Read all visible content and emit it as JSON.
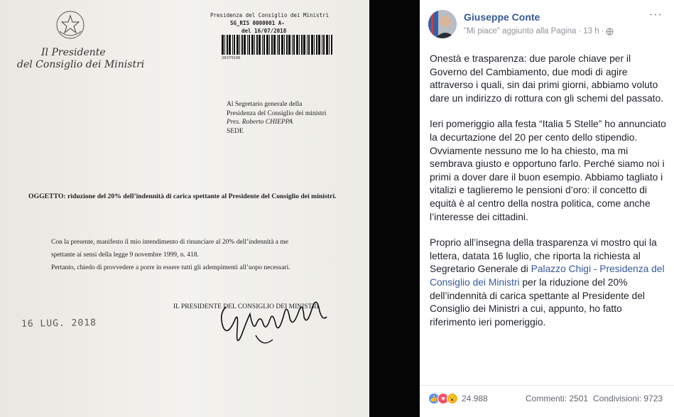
{
  "letter": {
    "ente_line1": "Il Presidente",
    "ente_line2": "del Consiglio dei Ministri",
    "protocol": [
      "Presidenza del Consiglio dei Ministri",
      "SG_RIS 0000001 A-",
      "del 16/07/2018"
    ],
    "barcode_number": "20379196",
    "recipient": [
      "Al Segretario generale della",
      "Presidenza del Consiglio dei ministri",
      "Pres. Roberto CHIEPPA",
      "SEDE"
    ],
    "subject_label": "OGGETTO:",
    "subject_text": "riduzione del 20% dell’indennità di carica spettante al Presidente del Consiglio dei ministri.",
    "body_line1": "Con la presente, manifesto il mio intendimento di rinunciare al 20% dell’indennità a me",
    "body_line2": "spettante ai sensi della legge 9 novembre 1999, n. 418.",
    "body_line3": "Pertanto, chiedo di provvedere a porre in essere tutti gli adempimenti all’uopo necessari.",
    "signer": "IL PRESIDENTE DEL CONSIGLIO DEI MINISTRI",
    "date_stamp": "16 LUG. 2018"
  },
  "post": {
    "author": "Giuseppe Conte",
    "meta_text": "\"Mi piace\" aggiunto alla Pagina",
    "time": "13 h",
    "more_icon": "···",
    "para1": "Onestà e trasparenza: due parole chiave per il Governo del Cambiamento, due modi di agire attraverso i quali, sin dai primi giorni, abbiamo voluto dare un indirizzo di rottura con gli schemi del passato.",
    "para2": "Ieri pomeriggio alla festa “Italia 5 Stelle” ho annunciato la decurtazione del 20 per cento dello stipendio. Ovviamente nessuno me lo ha chiesto, ma mi sembrava giusto e opportuno farlo. Perché siamo noi i primi a dover dare il buon esempio. Abbiamo tagliato i vitalizi e taglieremo le pensioni d’oro: il concetto di equità è al centro della nostra politica, come anche l’interesse dei cittadini.",
    "para3_before": "Proprio all’insegna della trasparenza vi mostro qui la lettera, datata 16 luglio, che riporta la richiesta al Segretario Generale di ",
    "para3_link": "Palazzo Chigi - Presidenza del Consiglio dei Ministri",
    "para3_after": " per la riduzione del 20% dell’indennità di carica spettante al Presidente del Consiglio dei Ministri a cui, appunto, ho fatto riferimento ieri pomeriggio.",
    "reaction_count": "24.988",
    "comments": "Commenti: 2501",
    "shares": "Condivisioni: 9723"
  },
  "colors": {
    "fb_blue": "#365899",
    "like": "#5890ff",
    "love": "#f25268",
    "wow": "#f7b125"
  }
}
